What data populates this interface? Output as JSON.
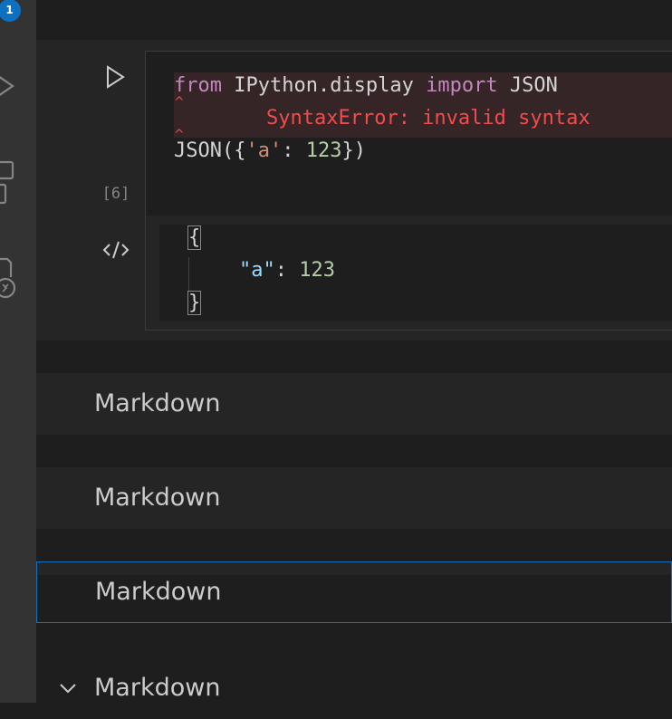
{
  "activity_bar": {
    "badge_count": "1"
  },
  "code_cell": {
    "execution_count": "[6]",
    "line1": {
      "kw1": "from",
      "module": " IPython.display ",
      "kw2": "import",
      "name": " JSON"
    },
    "error_message": "SyntaxError: invalid syntax",
    "line2": {
      "prefix": "JSON({",
      "str": "'a'",
      "colon": ": ",
      "num": "123",
      "suffix": "})"
    }
  },
  "output": {
    "open_brace": "{",
    "key": "\"a\"",
    "colon": ": ",
    "value": "123",
    "close_brace": "}"
  },
  "markdown_cells": [
    {
      "label": "Markdown"
    },
    {
      "label": "Markdown"
    },
    {
      "label": "Markdown"
    },
    {
      "label": "Markdown"
    }
  ],
  "colors": {
    "accent": "#0e70c0",
    "error": "#f14c4c",
    "keyword": "#c586c0",
    "string": "#ce9178",
    "number": "#b5cea8",
    "json_key": "#9cdcfe"
  }
}
